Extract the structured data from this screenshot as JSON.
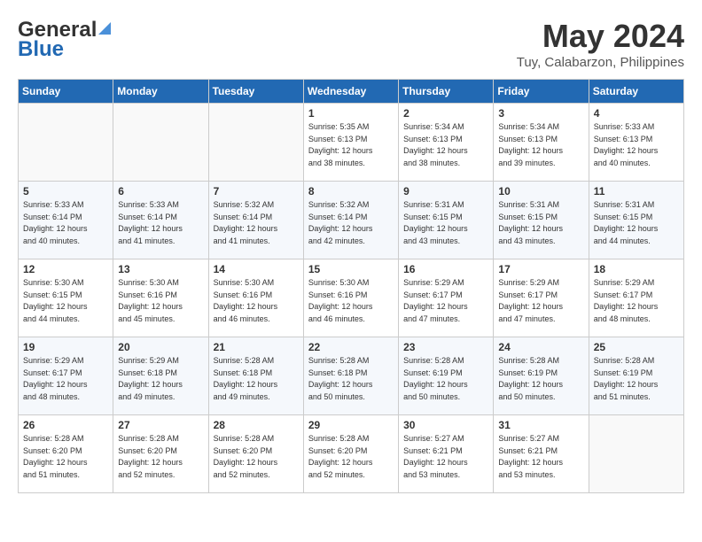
{
  "header": {
    "logo_line1": "General",
    "logo_line2": "Blue",
    "month": "May 2024",
    "location": "Tuy, Calabarzon, Philippines"
  },
  "weekdays": [
    "Sunday",
    "Monday",
    "Tuesday",
    "Wednesday",
    "Thursday",
    "Friday",
    "Saturday"
  ],
  "weeks": [
    [
      {
        "day": "",
        "info": ""
      },
      {
        "day": "",
        "info": ""
      },
      {
        "day": "",
        "info": ""
      },
      {
        "day": "1",
        "info": "Sunrise: 5:35 AM\nSunset: 6:13 PM\nDaylight: 12 hours\nand 38 minutes."
      },
      {
        "day": "2",
        "info": "Sunrise: 5:34 AM\nSunset: 6:13 PM\nDaylight: 12 hours\nand 38 minutes."
      },
      {
        "day": "3",
        "info": "Sunrise: 5:34 AM\nSunset: 6:13 PM\nDaylight: 12 hours\nand 39 minutes."
      },
      {
        "day": "4",
        "info": "Sunrise: 5:33 AM\nSunset: 6:13 PM\nDaylight: 12 hours\nand 40 minutes."
      }
    ],
    [
      {
        "day": "5",
        "info": "Sunrise: 5:33 AM\nSunset: 6:14 PM\nDaylight: 12 hours\nand 40 minutes."
      },
      {
        "day": "6",
        "info": "Sunrise: 5:33 AM\nSunset: 6:14 PM\nDaylight: 12 hours\nand 41 minutes."
      },
      {
        "day": "7",
        "info": "Sunrise: 5:32 AM\nSunset: 6:14 PM\nDaylight: 12 hours\nand 41 minutes."
      },
      {
        "day": "8",
        "info": "Sunrise: 5:32 AM\nSunset: 6:14 PM\nDaylight: 12 hours\nand 42 minutes."
      },
      {
        "day": "9",
        "info": "Sunrise: 5:31 AM\nSunset: 6:15 PM\nDaylight: 12 hours\nand 43 minutes."
      },
      {
        "day": "10",
        "info": "Sunrise: 5:31 AM\nSunset: 6:15 PM\nDaylight: 12 hours\nand 43 minutes."
      },
      {
        "day": "11",
        "info": "Sunrise: 5:31 AM\nSunset: 6:15 PM\nDaylight: 12 hours\nand 44 minutes."
      }
    ],
    [
      {
        "day": "12",
        "info": "Sunrise: 5:30 AM\nSunset: 6:15 PM\nDaylight: 12 hours\nand 44 minutes."
      },
      {
        "day": "13",
        "info": "Sunrise: 5:30 AM\nSunset: 6:16 PM\nDaylight: 12 hours\nand 45 minutes."
      },
      {
        "day": "14",
        "info": "Sunrise: 5:30 AM\nSunset: 6:16 PM\nDaylight: 12 hours\nand 46 minutes."
      },
      {
        "day": "15",
        "info": "Sunrise: 5:30 AM\nSunset: 6:16 PM\nDaylight: 12 hours\nand 46 minutes."
      },
      {
        "day": "16",
        "info": "Sunrise: 5:29 AM\nSunset: 6:17 PM\nDaylight: 12 hours\nand 47 minutes."
      },
      {
        "day": "17",
        "info": "Sunrise: 5:29 AM\nSunset: 6:17 PM\nDaylight: 12 hours\nand 47 minutes."
      },
      {
        "day": "18",
        "info": "Sunrise: 5:29 AM\nSunset: 6:17 PM\nDaylight: 12 hours\nand 48 minutes."
      }
    ],
    [
      {
        "day": "19",
        "info": "Sunrise: 5:29 AM\nSunset: 6:17 PM\nDaylight: 12 hours\nand 48 minutes."
      },
      {
        "day": "20",
        "info": "Sunrise: 5:29 AM\nSunset: 6:18 PM\nDaylight: 12 hours\nand 49 minutes."
      },
      {
        "day": "21",
        "info": "Sunrise: 5:28 AM\nSunset: 6:18 PM\nDaylight: 12 hours\nand 49 minutes."
      },
      {
        "day": "22",
        "info": "Sunrise: 5:28 AM\nSunset: 6:18 PM\nDaylight: 12 hours\nand 50 minutes."
      },
      {
        "day": "23",
        "info": "Sunrise: 5:28 AM\nSunset: 6:19 PM\nDaylight: 12 hours\nand 50 minutes."
      },
      {
        "day": "24",
        "info": "Sunrise: 5:28 AM\nSunset: 6:19 PM\nDaylight: 12 hours\nand 50 minutes."
      },
      {
        "day": "25",
        "info": "Sunrise: 5:28 AM\nSunset: 6:19 PM\nDaylight: 12 hours\nand 51 minutes."
      }
    ],
    [
      {
        "day": "26",
        "info": "Sunrise: 5:28 AM\nSunset: 6:20 PM\nDaylight: 12 hours\nand 51 minutes."
      },
      {
        "day": "27",
        "info": "Sunrise: 5:28 AM\nSunset: 6:20 PM\nDaylight: 12 hours\nand 52 minutes."
      },
      {
        "day": "28",
        "info": "Sunrise: 5:28 AM\nSunset: 6:20 PM\nDaylight: 12 hours\nand 52 minutes."
      },
      {
        "day": "29",
        "info": "Sunrise: 5:28 AM\nSunset: 6:20 PM\nDaylight: 12 hours\nand 52 minutes."
      },
      {
        "day": "30",
        "info": "Sunrise: 5:27 AM\nSunset: 6:21 PM\nDaylight: 12 hours\nand 53 minutes."
      },
      {
        "day": "31",
        "info": "Sunrise: 5:27 AM\nSunset: 6:21 PM\nDaylight: 12 hours\nand 53 minutes."
      },
      {
        "day": "",
        "info": ""
      }
    ]
  ]
}
